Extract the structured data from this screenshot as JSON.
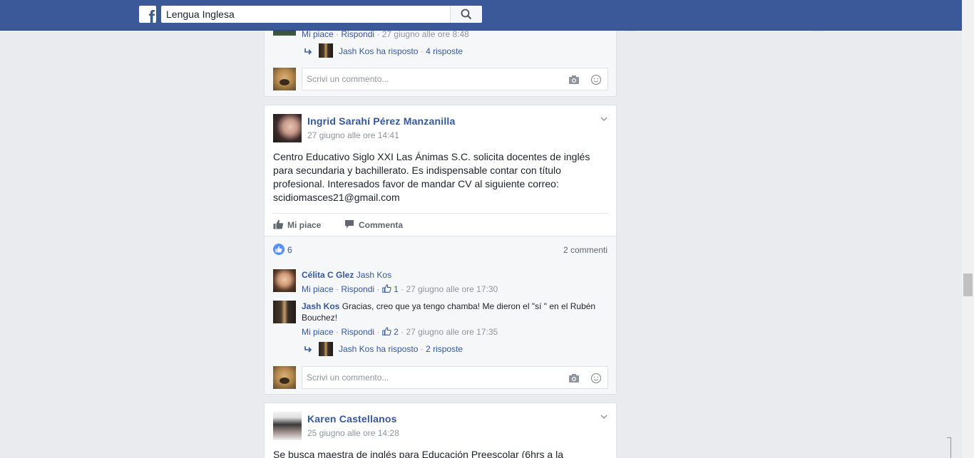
{
  "header": {
    "logo": "f",
    "search_value": "Lengua Inglesa"
  },
  "prev_post": {
    "comment_meta": {
      "like": "Mi piace",
      "reply": "Rispondi",
      "time": "27 giugno alle ore 8:48"
    },
    "reply_summary": {
      "author": "Jash Kos",
      "action": "ha risposto",
      "count": "4 risposte"
    },
    "write_placeholder": "Scrivi un commento..."
  },
  "post": {
    "author": "Ingrid Sarahí Pérez Manzanilla",
    "time": "27 giugno alle ore 14:41",
    "text": "Centro Educativo Siglo XXI Las Ánimas S.C. solicita docentes de inglés\npara secundaria y bachillerato. Es indispensable contar con título\nprofesional. Interesados favor de mandar CV al siguiente correo:\nscidiomasces21@gmail.com",
    "actions": {
      "like": "Mi piace",
      "comment": "Commenta"
    },
    "likes": "6",
    "comments_count": "2 commenti",
    "comments": [
      {
        "author": "Célita C Glez",
        "text": "Jash Kos",
        "like": "Mi piace",
        "reply": "Rispondi",
        "like_count": "1",
        "time": "27 giugno alle ore 17:30"
      },
      {
        "author": "Jash Kos",
        "text": "Gracias, creo que ya tengo chamba! Me dieron el \"sí \" en el Rubén Bouchez!",
        "like": "Mi piace",
        "reply": "Rispondi",
        "like_count": "2",
        "time": "27 giugno alle ore 17:35"
      }
    ],
    "reply_summary": {
      "author": "Jash Kos",
      "action": "ha risposto",
      "count": "2 risposte"
    },
    "write_placeholder": "Scrivi un commento..."
  },
  "next_post": {
    "author": "Karen Castellanos",
    "time": "25 giugno alle ore 14:28",
    "text": "Se busca maestra de inglés para Educación Preescolar (6hrs a la"
  },
  "colors": {
    "brand": "#3b5998",
    "link": "#365899",
    "meta": "#90949c",
    "like_badge": "#5890ff"
  },
  "icons": [
    "facebook-logo-icon",
    "search-icon",
    "reply-arrow-icon",
    "camera-icon",
    "smiley-icon",
    "chevron-down-icon",
    "thumbs-up-icon",
    "comment-icon"
  ]
}
